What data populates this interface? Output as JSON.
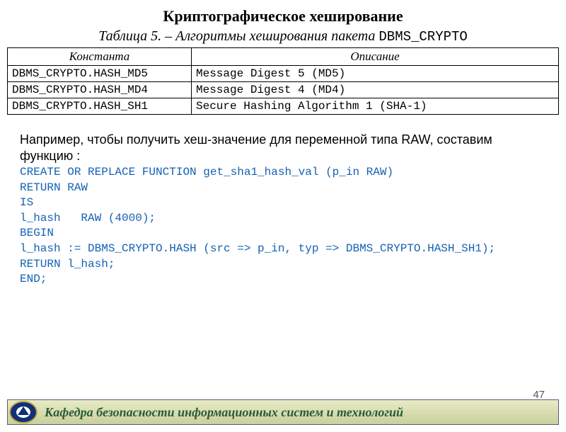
{
  "title": "Криптографическое хеширование",
  "table_caption": {
    "prefix": "Таблица 5. – Алгоритмы хеширования пакета ",
    "package": "DBMS_CRYPTO"
  },
  "table": {
    "headers": [
      "Константа",
      "Описание"
    ],
    "rows": [
      {
        "const": "DBMS_CRYPTO.HASH_MD5",
        "desc": "Message Digest 5 (MD5)"
      },
      {
        "const": "DBMS_CRYPTO.HASH_MD4",
        "desc": "Message Digest 4 (MD4)"
      },
      {
        "const": "DBMS_CRYPTO.HASH_SH1",
        "desc": "Secure Hashing Algorithm 1 (SHA-1)"
      }
    ]
  },
  "paragraph": "Например, чтобы получить хеш-значение для переменной типа RAW, составим функцию :",
  "code": "CREATE OR REPLACE FUNCTION get_sha1_hash_val (p_in RAW)\nRETURN RAW\nIS\nl_hash   RAW (4000);\nBEGIN\nl_hash := DBMS_CRYPTO.HASH (src => p_in, typ => DBMS_CRYPTO.HASH_SH1);\nRETURN l_hash;\nEND;",
  "page_number": "47",
  "footer": "Кафедра безопасности информационных систем и технологий"
}
